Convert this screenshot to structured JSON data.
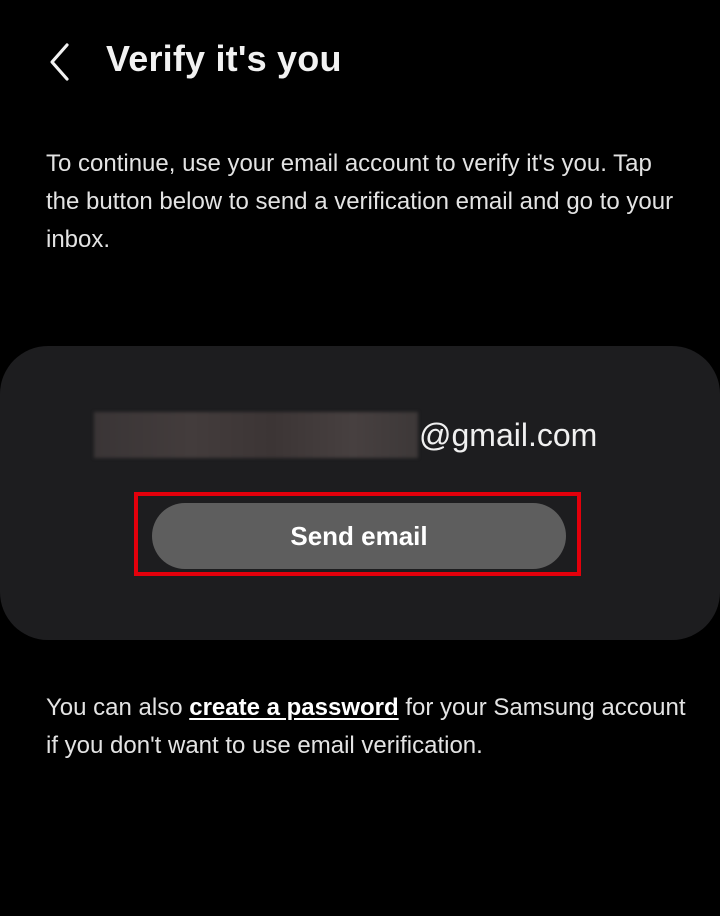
{
  "header": {
    "title": "Verify it's you",
    "back_icon": "chevron-left-icon"
  },
  "intro": {
    "text": "To continue, use your email account to verify it's you. Tap the button below to send a verification email and go to your inbox."
  },
  "card": {
    "email_domain": "@gmail.com",
    "send_button_label": "Send email",
    "highlight_color": "#e3000b"
  },
  "footer": {
    "text_before": "You can also ",
    "link_label": "create a password",
    "text_after": " for your Samsung account if you don't want to use email verification."
  },
  "colors": {
    "background": "#000000",
    "card": "#1d1d1f",
    "button": "#5e5e5e",
    "text": "#e3e3e3"
  }
}
